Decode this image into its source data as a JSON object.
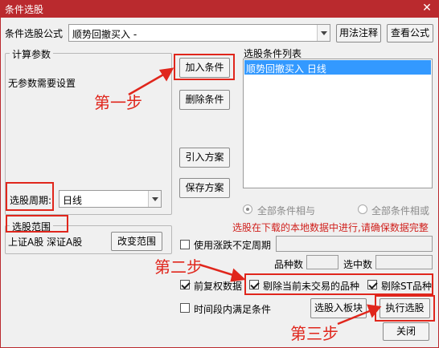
{
  "window": {
    "title": "条件选股",
    "close_glyph": "✕"
  },
  "formula": {
    "label": "条件选股公式",
    "value": "顺势回撤买入  -",
    "usage_button": "用法注释",
    "view_button": "查看公式"
  },
  "params": {
    "group_title": "计算参数",
    "none_text": "无参数需要设置",
    "period_label": "选股周期:",
    "period_value": "日线"
  },
  "actions": {
    "add": "加入条件",
    "delete": "删除条件",
    "import": "引入方案",
    "save": "保存方案"
  },
  "conditions": {
    "header": "选股条件列表",
    "items": [
      "顺势回撤买入  日线"
    ]
  },
  "logic": {
    "and_label": "全部条件相与",
    "or_label": "全部条件相或"
  },
  "notice": "选股在下载的本地数据中进行,请确保数据完整",
  "scope": {
    "group_title": "选股范围",
    "value": "上证A股  深证A股",
    "change_button": "改变范围"
  },
  "options": {
    "variable_period": {
      "label": "使用涨跌不定周期",
      "checked": false
    },
    "stock_count_label": "品种数",
    "selected_count_label": "选中数",
    "adjust": {
      "label": "前复权数据",
      "checked": true
    },
    "exclude_untraded": {
      "label": "剔除当前未交易的品种",
      "checked": true
    },
    "exclude_st": {
      "label": "剔除ST品种",
      "checked": true
    },
    "time_range": {
      "label": "时间段内满足条件",
      "checked": false
    }
  },
  "bottom": {
    "to_block": "选股入板块",
    "execute": "执行选股",
    "close": "关闭"
  },
  "annotations": {
    "step1": "第一步",
    "step2": "第二步",
    "step3": "第三步"
  },
  "colors": {
    "title_bar": "#ba2a2e",
    "annotation_red": "#e0261c",
    "notice_red": "#d0201c",
    "selection_blue": "#3399ff"
  }
}
